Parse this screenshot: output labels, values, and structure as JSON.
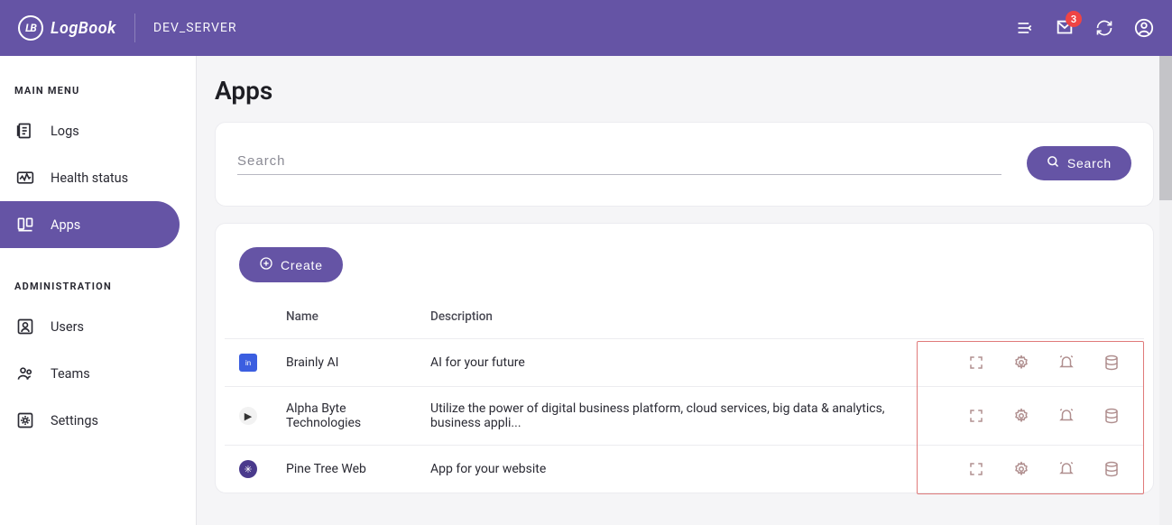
{
  "header": {
    "logo_text": "LogBook",
    "logo_icon_text": "LB",
    "server_name": "DEV_SERVER",
    "badge_count": "3"
  },
  "sidebar": {
    "heading_main": "MAIN MENU",
    "heading_admin": "ADMINISTRATION",
    "items_main": [
      {
        "label": "Logs"
      },
      {
        "label": "Health status"
      },
      {
        "label": "Apps"
      }
    ],
    "items_admin": [
      {
        "label": "Users"
      },
      {
        "label": "Teams"
      },
      {
        "label": "Settings"
      }
    ]
  },
  "main": {
    "page_title": "Apps",
    "search_placeholder": "Search",
    "search_button": "Search",
    "create_button": "Create",
    "table": {
      "col_name": "Name",
      "col_description": "Description",
      "rows": [
        {
          "name": "Brainly AI",
          "description": "AI for your future"
        },
        {
          "name": "Alpha Byte Technologies",
          "description": "Utilize the power of digital business platform, cloud services, big data & analytics, business appli..."
        },
        {
          "name": "Pine Tree Web",
          "description": "App for your website"
        }
      ]
    }
  }
}
